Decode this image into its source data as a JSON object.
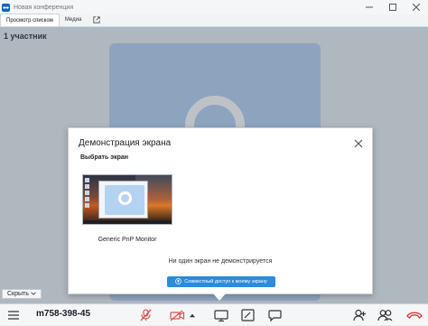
{
  "window": {
    "title": "Новая конференция"
  },
  "tabs": [
    {
      "label": "Просмотр списком",
      "active": true
    },
    {
      "label": "Медиа",
      "active": false
    }
  ],
  "participants_label": "1 участник",
  "dialog": {
    "title": "Демонстрация экрана",
    "subtitle": "Выбрать экран",
    "monitor_label": "Generic PnP Monitor",
    "status_text": "Ни один экран не демонстрируется",
    "share_button_label": "Совместный доступ к моему экрану"
  },
  "hide_button_label": "Скрыть",
  "toolbar": {
    "conference_id": "m758-398-45"
  },
  "colors": {
    "brand_blue": "#0e63c4",
    "video_tile": "#b4d2f1",
    "share_button": "#2b8be0",
    "mute_red": "#d9534f",
    "hangup_red": "#d32f2f"
  },
  "icons": {
    "app": "teamviewer-icon",
    "minimize": "minimize-icon",
    "maximize": "maximize-icon",
    "close": "close-icon",
    "external": "external-link-icon",
    "dialog_close": "close-icon",
    "share_btn": "share-screen-icon",
    "hide_chevron": "chevron-down-icon",
    "menu": "menu-icon",
    "mic": "microphone-muted-icon",
    "camera": "camera-muted-icon",
    "camera_options": "chevron-up-icon",
    "screen_share": "monitor-icon",
    "whiteboard": "whiteboard-icon",
    "chat": "chat-icon",
    "add_participant": "add-participant-icon",
    "participants": "participants-icon",
    "hangup": "hang-up-icon"
  }
}
